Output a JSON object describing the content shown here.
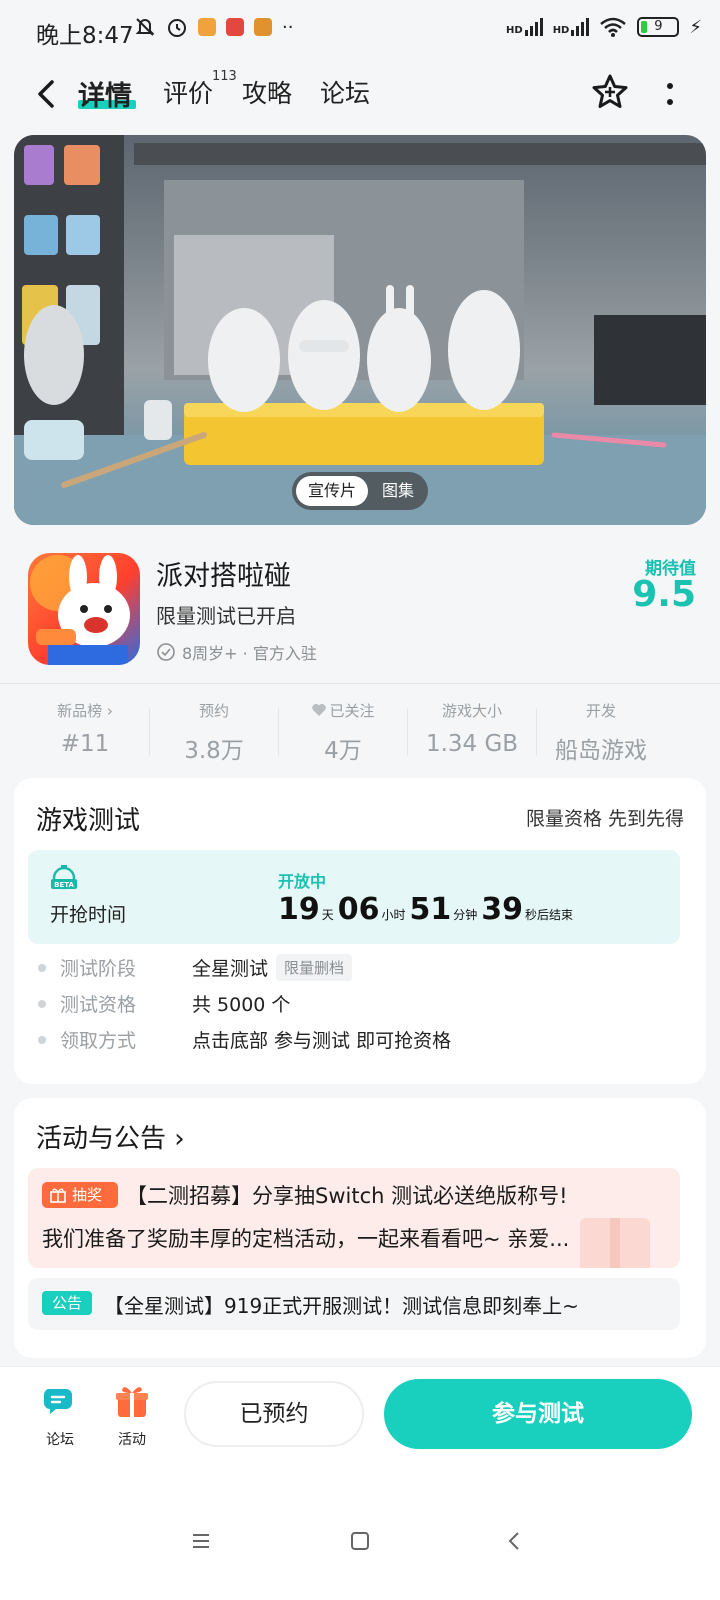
{
  "status_bar": {
    "time": "晚上8:47",
    "network": "HD",
    "battery": "9"
  },
  "nav": {
    "tabs": [
      {
        "label": "详情"
      },
      {
        "label": "评价"
      },
      {
        "label": "攻略"
      },
      {
        "label": "论坛"
      }
    ],
    "review_count": "113"
  },
  "media_toggle": {
    "trailer": "宣传片",
    "gallery": "图集"
  },
  "app": {
    "name": "派对搭啦碰",
    "subtitle": "限量测试已开启",
    "meta": "8周岁+ · 官方入驻",
    "expect_label": "期待值",
    "expect_score": "9.5"
  },
  "stats": [
    {
      "label": "新品榜 ›",
      "value": "#11"
    },
    {
      "label": "预约",
      "value": "3.8万"
    },
    {
      "label": "已关注",
      "value": "4万"
    },
    {
      "label": "游戏大小",
      "value": "1.34 GB"
    },
    {
      "label": "开发",
      "value": "船岛游戏"
    }
  ],
  "test_card": {
    "title": "游戏测试",
    "right_text": "限量资格 先到先得",
    "grab_label": "开抢时间",
    "open_status": "开放中",
    "countdown": {
      "days": "19",
      "days_unit": "天",
      "hours": "06",
      "hours_unit": "小时",
      "minutes": "51",
      "minutes_unit": "分钟",
      "seconds": "39",
      "seconds_unit": "秒后结束"
    },
    "rows": [
      {
        "label": "测试阶段",
        "value": "全星测试",
        "tag": "限量删档"
      },
      {
        "label": "测试资格",
        "value": "共 5000 个"
      },
      {
        "label": "领取方式",
        "value": "点击底部 参与测试 即可抢资格"
      }
    ]
  },
  "activity_card": {
    "title": "活动与公告 ›",
    "lottery_badge": "抽奖",
    "lottery_title": "【二测招募】分享抽Switch 测试必送绝版称号!",
    "lottery_desc": "我们准备了奖励丰厚的定档活动，一起来看看吧~ 亲爱...",
    "notice_badge": "公告",
    "notice_text": "【全星测试】919正式开服测试！测试信息即刻奉上~"
  },
  "bottom_bar": {
    "forum_label": "论坛",
    "activity_label": "活动",
    "reserved_label": "已预约",
    "join_label": "参与测试"
  },
  "colors": {
    "accent": "#19d0bf",
    "lottery": "#ff6b3d"
  }
}
